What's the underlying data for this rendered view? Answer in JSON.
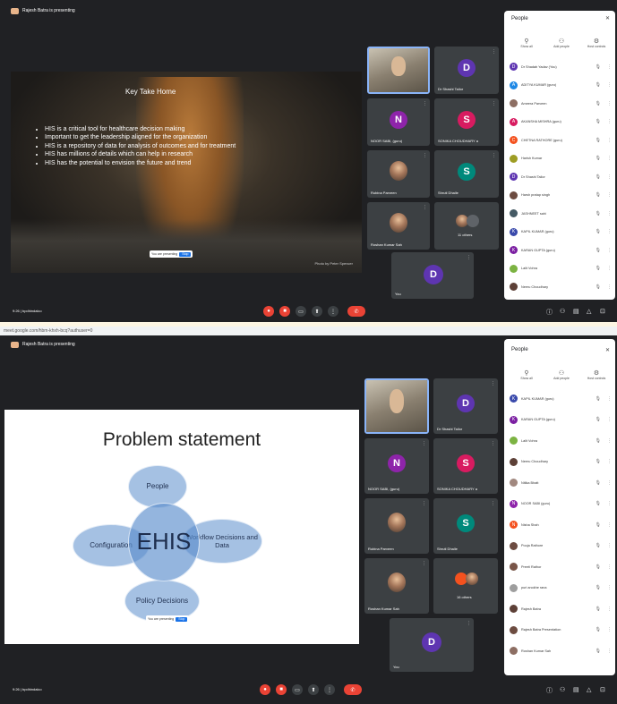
{
  "top": {
    "window_title": "Rajesh Batra is presenting",
    "slide": {
      "heading": "Key Take Home",
      "bullets": [
        "HIS is a critical tool for healthcare decision making",
        "Important to get the leadership aligned for the organization",
        "HIS is a repository of data for analysis of outcomes and for treatment",
        "HIS has millions of details which can help in research",
        "HIS has the potential to envision the future and trend"
      ],
      "credit": "Photo by Peter Spencer"
    },
    "share_control": {
      "text": "You are presenting",
      "stop": "Stop"
    },
    "tiles": [
      {
        "name": "",
        "initial": ""
      },
      {
        "name": "Dr Shashi Tailor",
        "initial": "D",
        "color": "#5e35b1"
      },
      {
        "name": "NOOR SABI, (guru)",
        "initial": "N",
        "color": "#8e24aa"
      },
      {
        "name": "SONIKA CHOUDHARY a",
        "initial": "S",
        "color": "#d81b60"
      },
      {
        "name": "Rubina Parveen",
        "initial": "",
        "color": ""
      },
      {
        "name": "Shruti Dhalle",
        "initial": "S",
        "color": "#00897b"
      },
      {
        "name": "Roshan Kumar Sah",
        "initial": "",
        "color": ""
      },
      {
        "name": "11 others",
        "initial": "",
        "color": ""
      },
      {
        "name": "You",
        "initial": "D",
        "color": "#5e35b1"
      }
    ],
    "people": {
      "title": "People",
      "tabs": [
        "Show all",
        "Add people",
        "Host controls"
      ],
      "rows": [
        {
          "name": "Dr Shadab Yadav (You)",
          "initial": "D",
          "color": "#5e35b1"
        },
        {
          "name": "ADITYA KUMAR (guru)",
          "initial": "A",
          "color": "#1e88e5"
        },
        {
          "name": "Ameera Parveen",
          "initial": "",
          "color": "#8d6e63"
        },
        {
          "name": "AKANSHA MISHRA (guru)",
          "initial": "A",
          "color": "#d81b60"
        },
        {
          "name": "CHETNA RATHORE (guru)",
          "initial": "C",
          "color": "#f4511e"
        },
        {
          "name": "Harish Kumar",
          "initial": "",
          "color": "#9e9d24"
        },
        {
          "name": "Dr Shashi Tailor",
          "initial": "D",
          "color": "#5e35b1"
        },
        {
          "name": "Harsh pratap singh",
          "initial": "",
          "color": "#6d4c41"
        },
        {
          "name": "JASHNEET sahi",
          "initial": "",
          "color": "#455a64"
        },
        {
          "name": "KAPIL KUMAR (guru)",
          "initial": "K",
          "color": "#3949ab"
        },
        {
          "name": "KARAN GUPTA (guru)",
          "initial": "K",
          "color": "#7b1fa2"
        },
        {
          "name": "Lalit Vohra",
          "initial": "",
          "color": "#7cb342"
        },
        {
          "name": "Neeru Choudhary",
          "initial": "",
          "color": "#5d4037"
        }
      ]
    },
    "bottom": {
      "time": "9:26 | bpdhindalco"
    }
  },
  "bottom": {
    "urlbar": "meet.google.com/hbm-khxh-bcq?authuser=0",
    "window_title": "Rajesh Batra is presenting",
    "slide": {
      "title": "Problem statement",
      "center": "EHIS",
      "circles": [
        "People",
        "Configuration",
        "Workflow Decisions and Data",
        "Policy Decisions"
      ]
    },
    "share_control": {
      "text": "You are presenting",
      "stop": "Stop"
    },
    "tiles": [
      {
        "name": "",
        "initial": ""
      },
      {
        "name": "Dr Shashi Tailor",
        "initial": "D",
        "color": "#5e35b1"
      },
      {
        "name": "NOOR SABI, (guru)",
        "initial": "N",
        "color": "#8e24aa"
      },
      {
        "name": "SONIKA CHOUDHARY a",
        "initial": "S",
        "color": "#d81b60"
      },
      {
        "name": "Rubina Parveen",
        "initial": "",
        "color": ""
      },
      {
        "name": "Shruti Dhalle",
        "initial": "S",
        "color": "#00897b"
      },
      {
        "name": "Roshan Kumar Sah",
        "initial": "",
        "color": ""
      },
      {
        "name": "16 others",
        "initial": "",
        "color": ""
      },
      {
        "name": "You",
        "initial": "D",
        "color": "#5e35b1"
      }
    ],
    "people": {
      "title": "People",
      "tabs": [
        "Show all",
        "Add people",
        "Host controls"
      ],
      "rows": [
        {
          "name": "KAPIL KUMAR (guru)",
          "initial": "K",
          "color": "#3949ab"
        },
        {
          "name": "KARAN GUPTA (guru)",
          "initial": "K",
          "color": "#7b1fa2"
        },
        {
          "name": "Lalit Vohra",
          "initial": "",
          "color": "#7cb342"
        },
        {
          "name": "Neeru Choudhary",
          "initial": "",
          "color": "#5d4037"
        },
        {
          "name": "Nitika Bhatt",
          "initial": "",
          "color": "#a1887f"
        },
        {
          "name": "NOOR SABI (guru)",
          "initial": "N",
          "color": "#8e24aa"
        },
        {
          "name": "Nisha Shah",
          "initial": "N",
          "color": "#f4511e"
        },
        {
          "name": "Pooja Rathore",
          "initial": "",
          "color": "#6d4c41"
        },
        {
          "name": "Preeti Rathor",
          "initial": "",
          "color": "#795548"
        },
        {
          "name": "puri anokhe rana",
          "initial": "",
          "color": "#9e9e9e"
        },
        {
          "name": "Rajesh Batra",
          "initial": "",
          "color": "#5d4037"
        },
        {
          "name": "Rajesh Batra Presentation",
          "initial": "",
          "color": "#6d4c41"
        },
        {
          "name": "Roshan Kumar Sah",
          "initial": "",
          "color": "#8d6e63"
        }
      ]
    },
    "bottom": {
      "time": "9:26 | bpdhindalco"
    }
  }
}
